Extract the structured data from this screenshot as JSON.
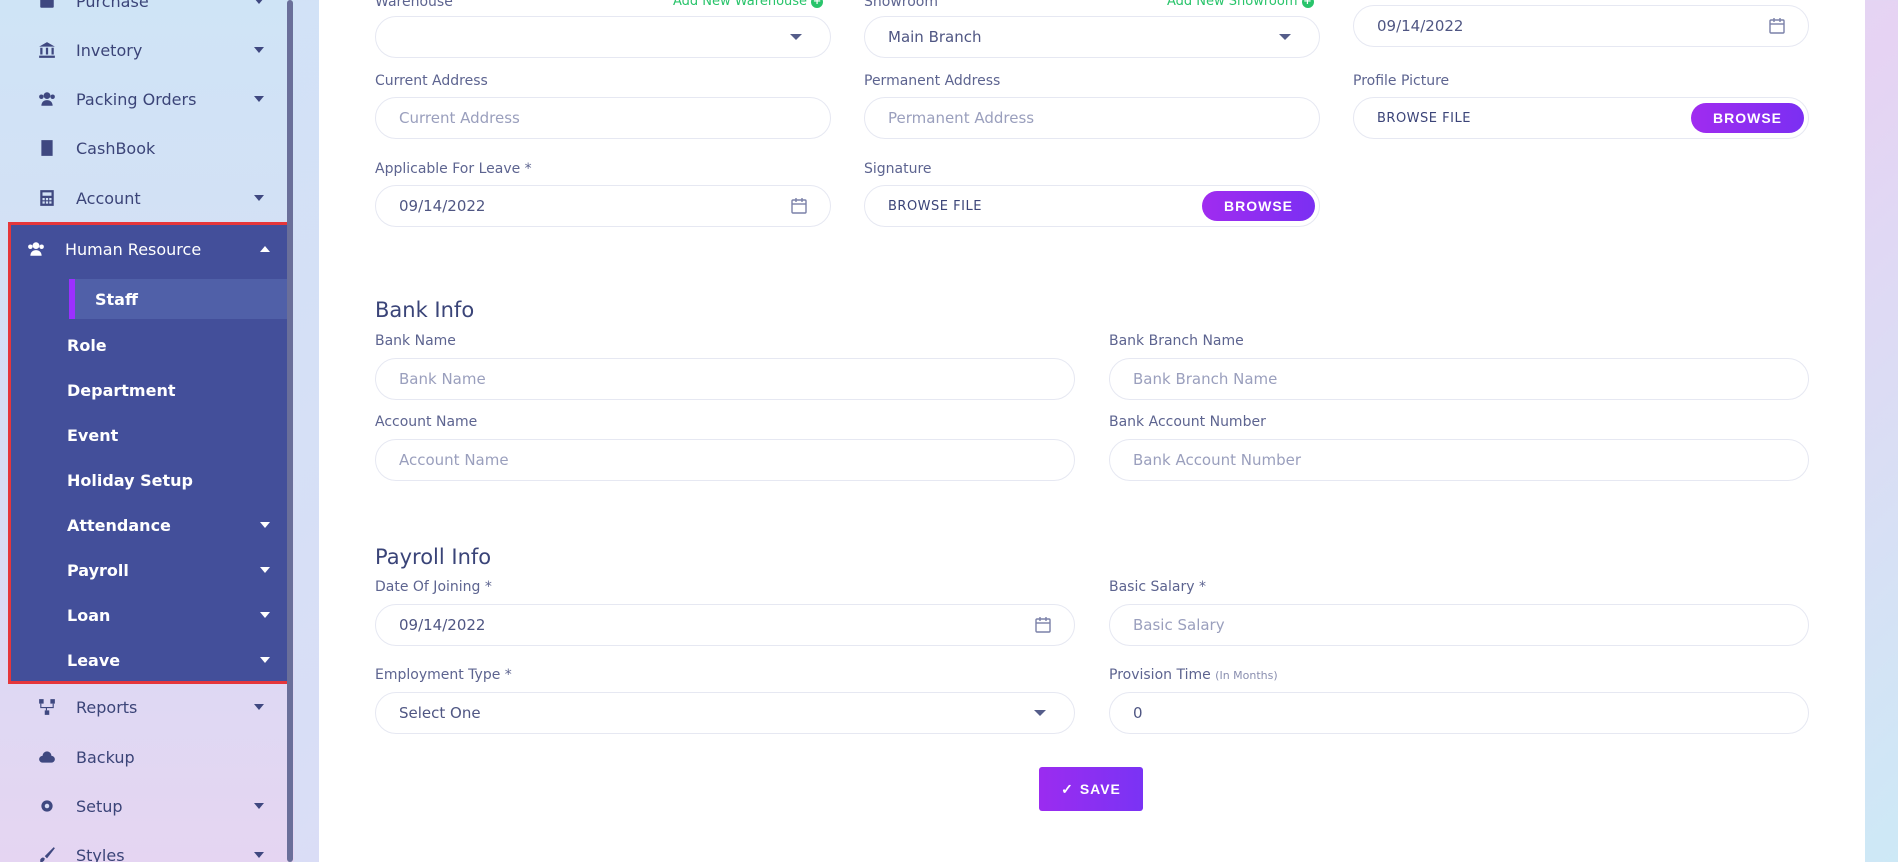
{
  "sidebar": {
    "items_top": [
      {
        "label": "Purchase",
        "icon": "purchase-icon"
      },
      {
        "label": "Invetory",
        "icon": "bank-icon"
      },
      {
        "label": "Packing Orders",
        "icon": "users-icon"
      },
      {
        "label": "CashBook",
        "icon": "book-icon"
      },
      {
        "label": "Account",
        "icon": "calculator-icon"
      }
    ],
    "hr": {
      "label": "Human Resource",
      "icon": "users-icon",
      "active": "Staff",
      "children": [
        "Role",
        "Department",
        "Event",
        "Holiday Setup",
        "Attendance",
        "Payroll",
        "Loan",
        "Leave"
      ]
    },
    "items_bottom": [
      {
        "label": "Reports",
        "icon": "sitemap-icon"
      },
      {
        "label": "Backup",
        "icon": "cloud-download-icon"
      },
      {
        "label": "Setup",
        "icon": "gear-icon"
      },
      {
        "label": "Styles",
        "icon": "brush-icon"
      }
    ]
  },
  "form": {
    "warehouse": {
      "label": "Warehouse",
      "add_new": "Add New Warehouse",
      "value": ""
    },
    "showroom": {
      "label": "Showroom",
      "add_new": "Add New Showroom",
      "value": "Main Branch"
    },
    "top_date": {
      "value": "09/14/2022"
    },
    "current_address": {
      "label": "Current Address",
      "placeholder": "Current Address"
    },
    "permanent_address": {
      "label": "Permanent Address",
      "placeholder": "Permanent Address"
    },
    "profile_picture": {
      "label": "Profile Picture",
      "file_text": "BROWSE FILE",
      "button": "BROWSE"
    },
    "applicable_leave": {
      "label": "Applicable For Leave *",
      "value": "09/14/2022"
    },
    "signature": {
      "label": "Signature",
      "file_text": "BROWSE FILE",
      "button": "BROWSE"
    },
    "bank_info": {
      "title": "Bank Info",
      "bank_name": {
        "label": "Bank Name",
        "placeholder": "Bank Name"
      },
      "bank_branch": {
        "label": "Bank Branch Name",
        "placeholder": "Bank Branch Name"
      },
      "account_name": {
        "label": "Account Name",
        "placeholder": "Account Name"
      },
      "account_number": {
        "label": "Bank Account Number",
        "placeholder": "Bank Account Number"
      }
    },
    "payroll_info": {
      "title": "Payroll Info",
      "date_of_joining": {
        "label": "Date Of Joining *",
        "value": "09/14/2022"
      },
      "basic_salary": {
        "label": "Basic Salary *",
        "placeholder": "Basic Salary"
      },
      "employment_type": {
        "label": "Employment Type *",
        "value": "Select One"
      },
      "provision_time": {
        "label": "Provision Time",
        "hint": "(In Months)",
        "value": "0"
      }
    },
    "save_label": "SAVE"
  },
  "colors": {
    "accent": "#8b2ff2",
    "sidebar_active": "#434f9a",
    "highlight_border": "#e5363b",
    "add_new": "#29c46b"
  }
}
